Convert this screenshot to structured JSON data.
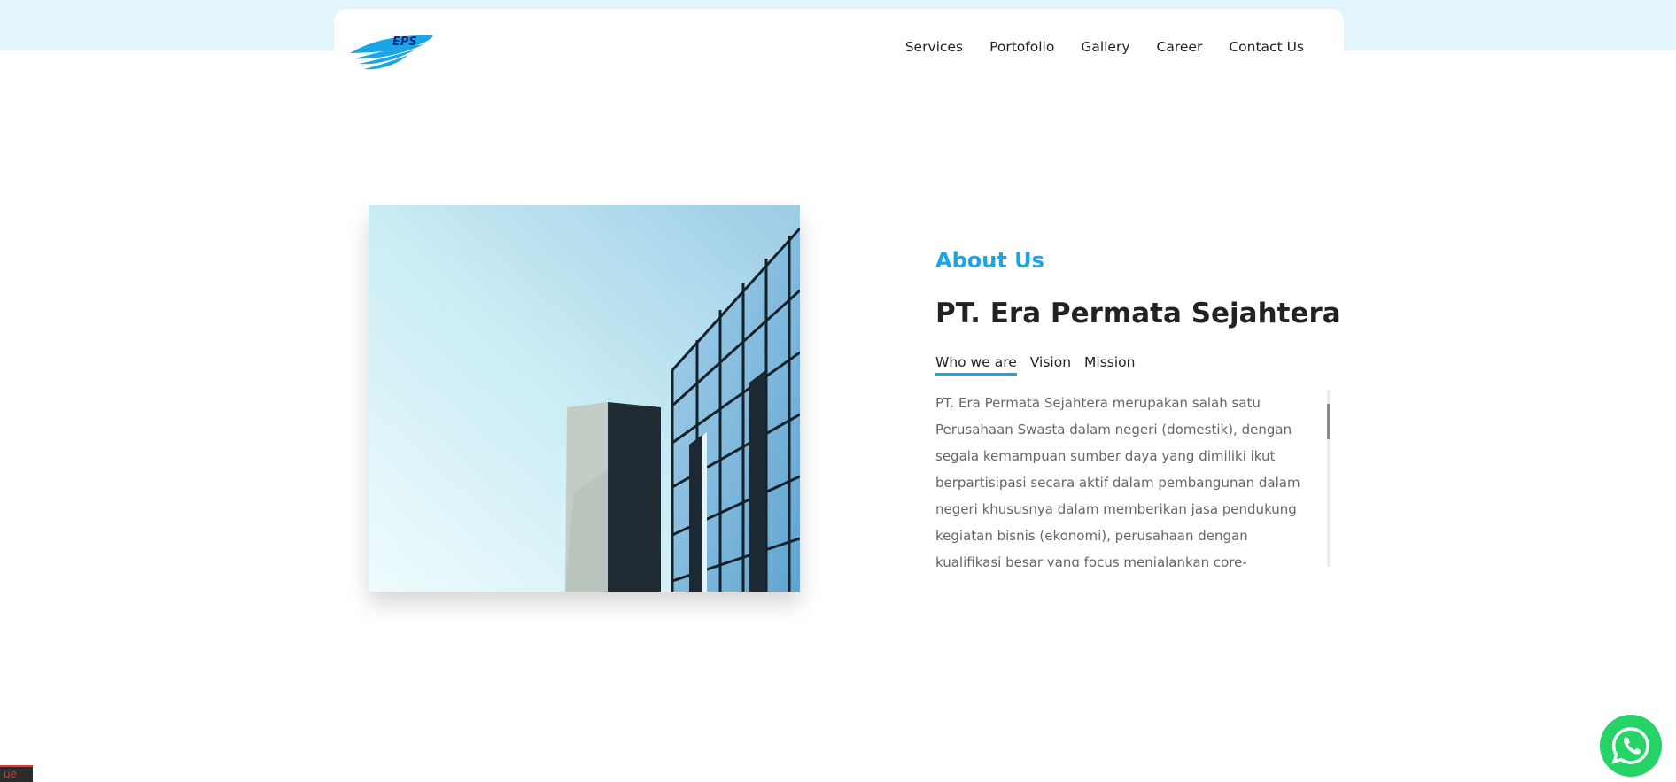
{
  "logo": {
    "text": "EPS"
  },
  "nav": {
    "items": [
      {
        "label": "Services"
      },
      {
        "label": "Portofolio"
      },
      {
        "label": "Gallery"
      },
      {
        "label": "Career"
      },
      {
        "label": "Contact Us"
      }
    ]
  },
  "about": {
    "label": "About Us",
    "title": "PT. Era Permata Sejahtera",
    "tabs": [
      {
        "label": "Who we are",
        "active": true
      },
      {
        "label": "Vision",
        "active": false
      },
      {
        "label": "Mission",
        "active": false
      }
    ],
    "text": "PT. Era Permata Sejahtera merupakan salah satu Perusahaan Swasta dalam negeri (domestik), dengan segala kemampuan sumber daya yang dimiliki ikut berpartisipasi secara aktif dalam pembangunan dalam negeri khususnya dalam memberikan jasa pendukung kegiatan bisnis (ekonomi), perusahaan dengan kualifikasi besar yang focus menjalankan core-"
  },
  "colors": {
    "accent": "#1aa6e6",
    "top_band": "#e3f5fc",
    "whatsapp": "#25d366"
  },
  "icons": {
    "whatsapp": "whatsapp-icon",
    "logo": "eps-logo"
  },
  "corner_badge": "ue"
}
